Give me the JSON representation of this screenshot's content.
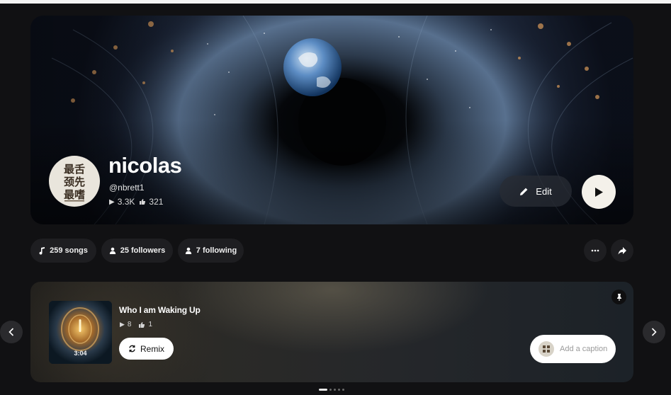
{
  "profile": {
    "name": "nicolas",
    "handle": "@nbrett1",
    "plays": "3.3K",
    "likes": "321",
    "avatar_text": [
      "最舌",
      "颈先",
      "最嗜"
    ],
    "edit_label": "Edit"
  },
  "stats": {
    "songs": "259 songs",
    "followers": "25 followers",
    "following": "7 following"
  },
  "song": {
    "title": "Who I am Waking Up",
    "plays": "8",
    "likes": "1",
    "duration": "3:04",
    "remix_label": "Remix",
    "caption_placeholder": "Add a caption"
  },
  "carousel": {
    "total": 5,
    "active_index": 0
  },
  "icons": {
    "play": "play-icon",
    "like": "thumbs-up-icon",
    "edit": "pencil-icon",
    "note": "music-note-icon",
    "user": "user-icon",
    "more": "more-horizontal-icon",
    "share": "share-icon",
    "pin": "pin-icon",
    "remix": "remix-icon",
    "prev": "chevron-left-icon",
    "next": "chevron-right-icon"
  },
  "colors": {
    "background": "#111113",
    "pill": "#1e1e21",
    "play_button": "#f4f1ea"
  }
}
